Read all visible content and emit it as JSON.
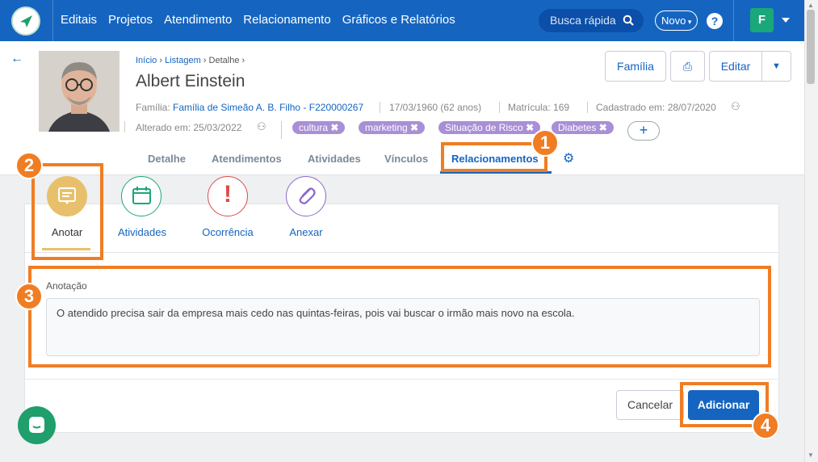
{
  "nav": {
    "items": [
      "Editais",
      "Projetos",
      "Atendimento",
      "Relacionamento",
      "Gráficos e Relatórios"
    ],
    "search_label": "Busca rápida",
    "new_label": "Novo",
    "help": "?",
    "user_initial": "F"
  },
  "breadcrumb": {
    "home": "Início",
    "list": "Listagem",
    "current": "Detalhe"
  },
  "person": {
    "name": "Albert Einstein",
    "family_label": "Família:",
    "family_value": "Família de Simeão A. B. Filho - F220000267",
    "birth": "17/03/1960 (62 anos)",
    "matricula": "Matrícula: 169",
    "cadastrado": "Cadastrado em: 28/07/2020",
    "alterado": "Alterado em: 25/03/2022"
  },
  "tags": [
    "cultura",
    "marketing",
    "Situação de Risco",
    "Diabetes"
  ],
  "add_tag": "+",
  "buttons": {
    "familia": "Família",
    "editar": "Editar",
    "cancelar": "Cancelar",
    "adicionar": "Adicionar"
  },
  "tabs": [
    "Detalhe",
    "Atendimentos",
    "Atividades",
    "Vínculos",
    "Relacionamentos"
  ],
  "actions": [
    {
      "label": "Anotar",
      "color": "#e8c06b",
      "icon": "note-icon"
    },
    {
      "label": "Atividades",
      "color": "#1aa77a",
      "icon": "calendar-icon"
    },
    {
      "label": "Ocorrência",
      "color": "#e04a4a",
      "icon": "alert-icon"
    },
    {
      "label": "Anexar",
      "color": "#8a68c9",
      "icon": "paperclip-icon"
    }
  ],
  "form": {
    "label": "Anotação",
    "value": "O atendido precisa sair da empresa mais cedo nas quintas-feiras, pois vai buscar o irmão mais novo na escola."
  },
  "callouts": [
    "1",
    "2",
    "3",
    "4"
  ],
  "colors": {
    "primary": "#1565c0",
    "callout": "#f07d23",
    "tag": "#a98fd6"
  }
}
